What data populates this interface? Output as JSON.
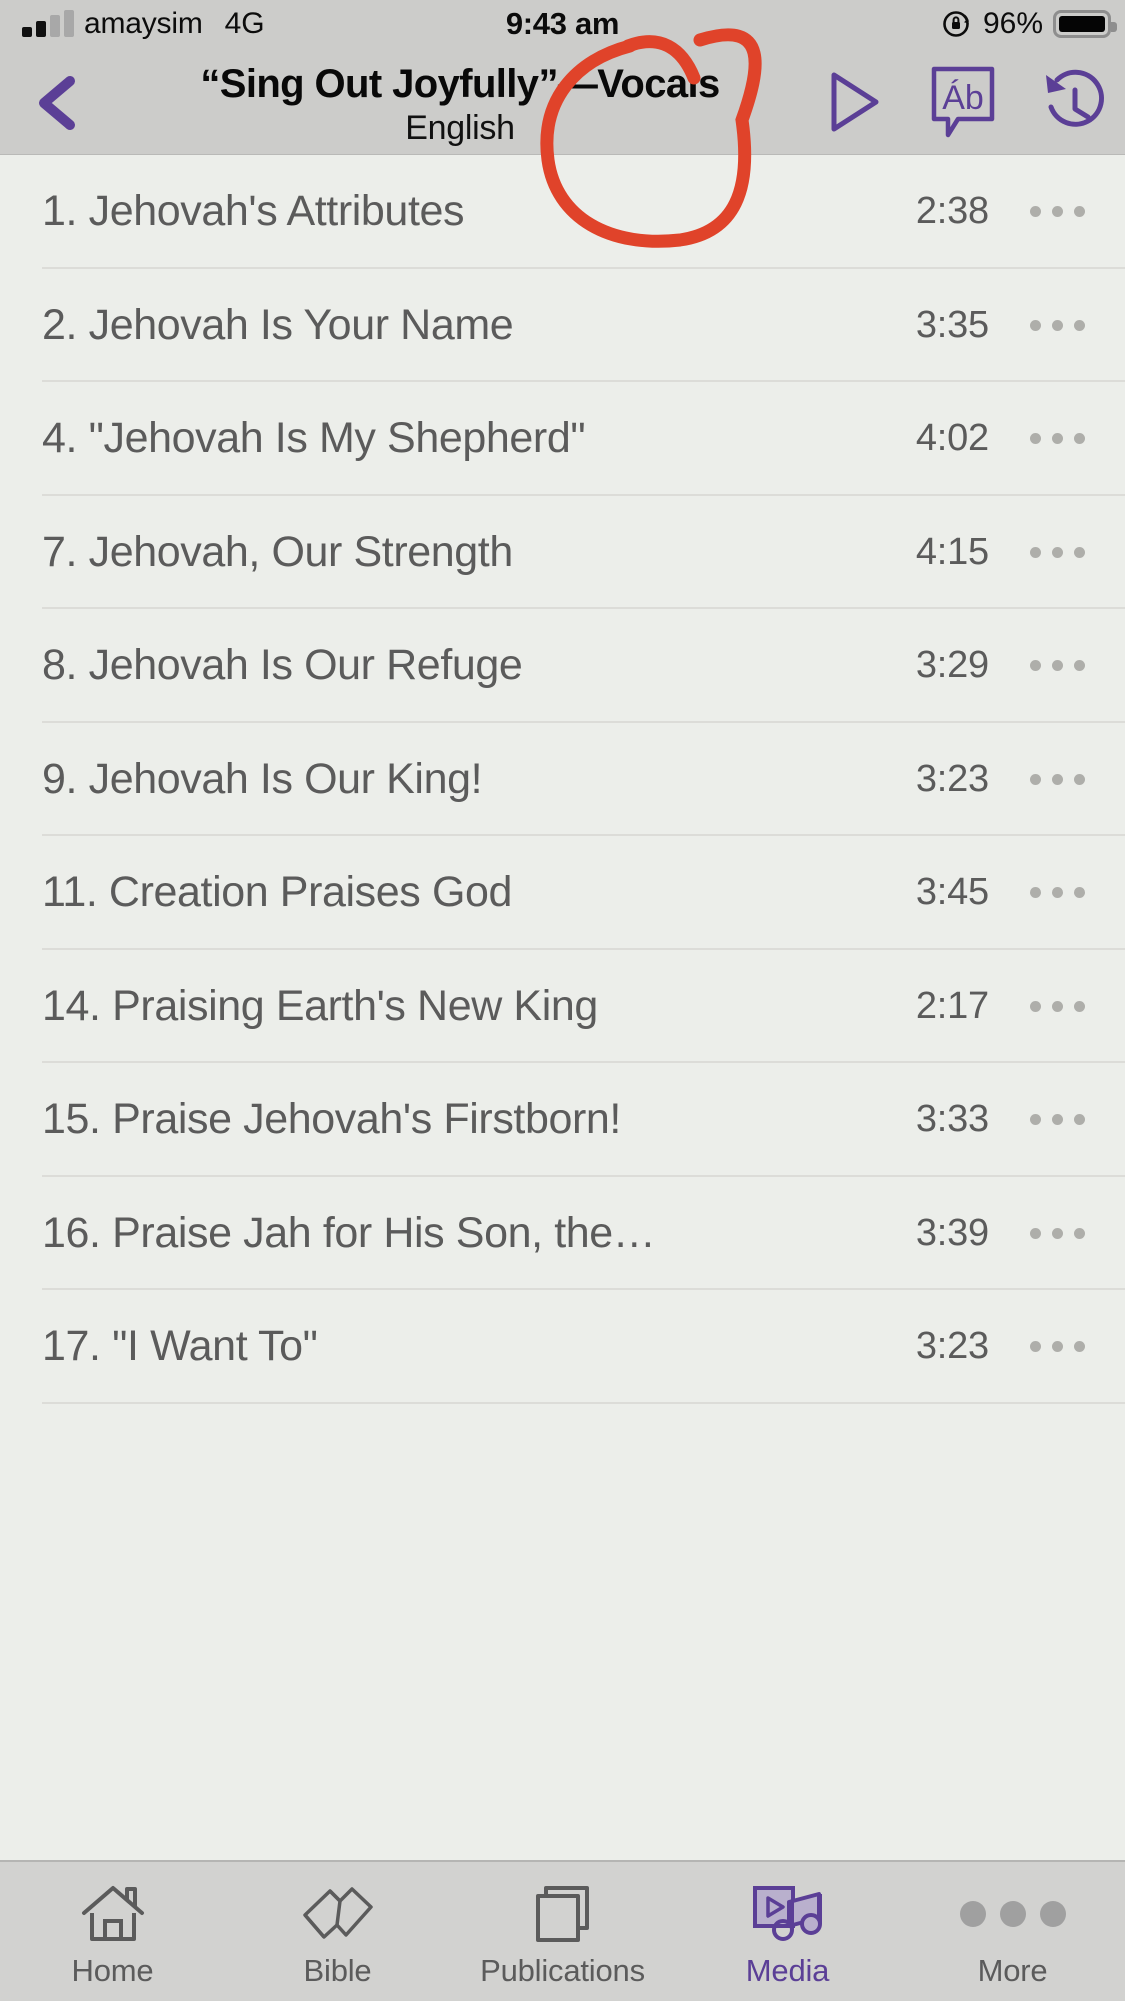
{
  "status_bar": {
    "carrier": "amaysim",
    "network": "4G",
    "time": "9:43 am",
    "battery_percent": "96%",
    "rotation_lock_icon": "rotation-lock-icon",
    "signal_icon": "signal-bars-icon",
    "battery_icon": "battery-icon"
  },
  "nav_bar": {
    "back_icon": "chevron-left-icon",
    "title": "“Sing Out Joyfully”—Vocals",
    "subtitle": "English",
    "actions": [
      {
        "name": "play-all-button",
        "icon": "play-triangle-icon"
      },
      {
        "name": "language-button",
        "icon": "language-speech-bubble-icon",
        "glyph": "Áb"
      },
      {
        "name": "history-button",
        "icon": "history-clock-icon"
      }
    ]
  },
  "list": {
    "more_icon": "ellipsis-icon",
    "rows": [
      {
        "title": "1. Jehovah's Attributes",
        "duration": "2:38"
      },
      {
        "title": "2. Jehovah Is Your Name",
        "duration": "3:35"
      },
      {
        "title": "4. \"Jehovah Is My Shepherd\"",
        "duration": "4:02"
      },
      {
        "title": "7. Jehovah, Our Strength",
        "duration": "4:15"
      },
      {
        "title": "8. Jehovah Is Our Refuge",
        "duration": "3:29"
      },
      {
        "title": "9. Jehovah Is Our King!",
        "duration": "3:23"
      },
      {
        "title": "11. Creation Praises God",
        "duration": "3:45"
      },
      {
        "title": "14. Praising Earth's New King",
        "duration": "2:17"
      },
      {
        "title": "15. Praise Jehovah's Firstborn!",
        "duration": "3:33"
      },
      {
        "title": "16. Praise Jah for His Son, the…",
        "duration": "3:39"
      },
      {
        "title": "17. \"I Want To\"",
        "duration": "3:23"
      }
    ]
  },
  "tab_bar": {
    "tabs": [
      {
        "label": "Home",
        "icon": "house-icon",
        "active": false
      },
      {
        "label": "Bible",
        "icon": "open-book-icon",
        "active": false
      },
      {
        "label": "Publications",
        "icon": "stacked-pages-icon",
        "active": false
      },
      {
        "label": "Media",
        "icon": "media-play-music-icon",
        "active": true
      },
      {
        "label": "More",
        "icon": "three-dots-icon",
        "active": false
      }
    ]
  },
  "annotation": {
    "name": "red-circle-highlight",
    "color": "#e0432a",
    "targets": "play-all-button"
  },
  "colors": {
    "accent_purple": "#5b3f96",
    "chrome_grey": "#ccccca",
    "list_bg": "#eceeea",
    "text_grey": "#5b5b5b",
    "annotation_red": "#e0432a"
  }
}
